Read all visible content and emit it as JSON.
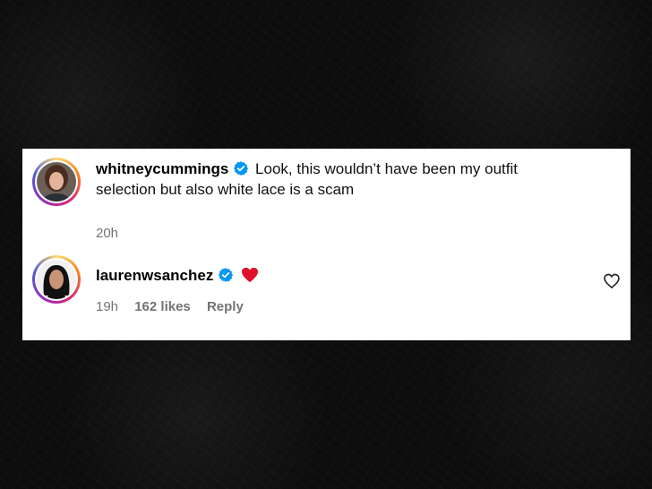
{
  "comments": [
    {
      "username": "whitneycummings",
      "verified": true,
      "text": "Look, this wouldn’t have been my outfit selection but also white lace is a scam",
      "time": "20h"
    },
    {
      "username": "laurenwsanchez",
      "verified": true,
      "emoji": "red-heart",
      "time": "19h",
      "likes": "162 likes",
      "reply_label": "Reply"
    }
  ],
  "icons": {
    "verified": "verified-badge-icon",
    "like": "heart-outline-icon",
    "verified_color": "#0095F6"
  }
}
